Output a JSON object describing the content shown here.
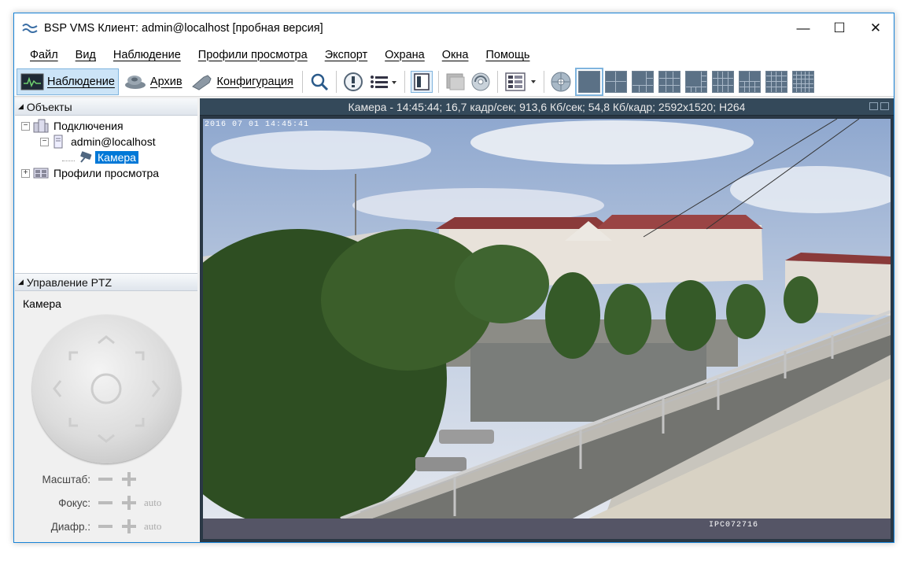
{
  "window": {
    "title": "BSP VMS Клиент: admin@localhost [пробная версия]",
    "controls": {
      "minimize": "—",
      "maximize": "☐",
      "close": "✕"
    }
  },
  "menu": [
    "Файл",
    "Вид",
    "Наблюдение",
    "Профили просмотра",
    "Экспорт",
    "Охрана",
    "Окна",
    "Помощь"
  ],
  "toolbar": {
    "surveillance_label": "Наблюдение",
    "archive_label": "Архив",
    "config_label": "Конфигурация",
    "icons": [
      "search-icon",
      "alert-icon",
      "list-icon",
      "single-view-icon",
      "disabled-view-icon",
      "refresh-disc-icon",
      "layout-menu-icon",
      "globe-disc-icon"
    ],
    "layouts": [
      "1x1",
      "2x2",
      "1+5",
      "3x3",
      "1+7",
      "3x4",
      "2+8",
      "4x4",
      "5x5"
    ],
    "active_layout": "1x1"
  },
  "objects_panel": {
    "header": "Объекты",
    "tree": {
      "connections": "Подключения",
      "server": "admin@localhost",
      "camera": "Камера",
      "profiles": "Профили просмотра"
    }
  },
  "ptz_panel": {
    "header": "Управление PTZ",
    "camera_label": "Камера",
    "zoom_label": "Масштаб:",
    "focus_label": "Фокус:",
    "iris_label": "Диафр.:",
    "auto": "auto"
  },
  "video": {
    "header": "Камера - 14:45:44; 16,7 кадр/сек; 913,6 Кб/сек; 54,8 Кб/кадр; 2592x1520; H264",
    "timestamp_overlay": "2016 07 01 14:45:41",
    "camera_id_overlay": "IPC072716"
  },
  "colors": {
    "accent": "#0078d7",
    "video_header_bg": "#34495a",
    "panel_bg": "#f0f0f0"
  }
}
